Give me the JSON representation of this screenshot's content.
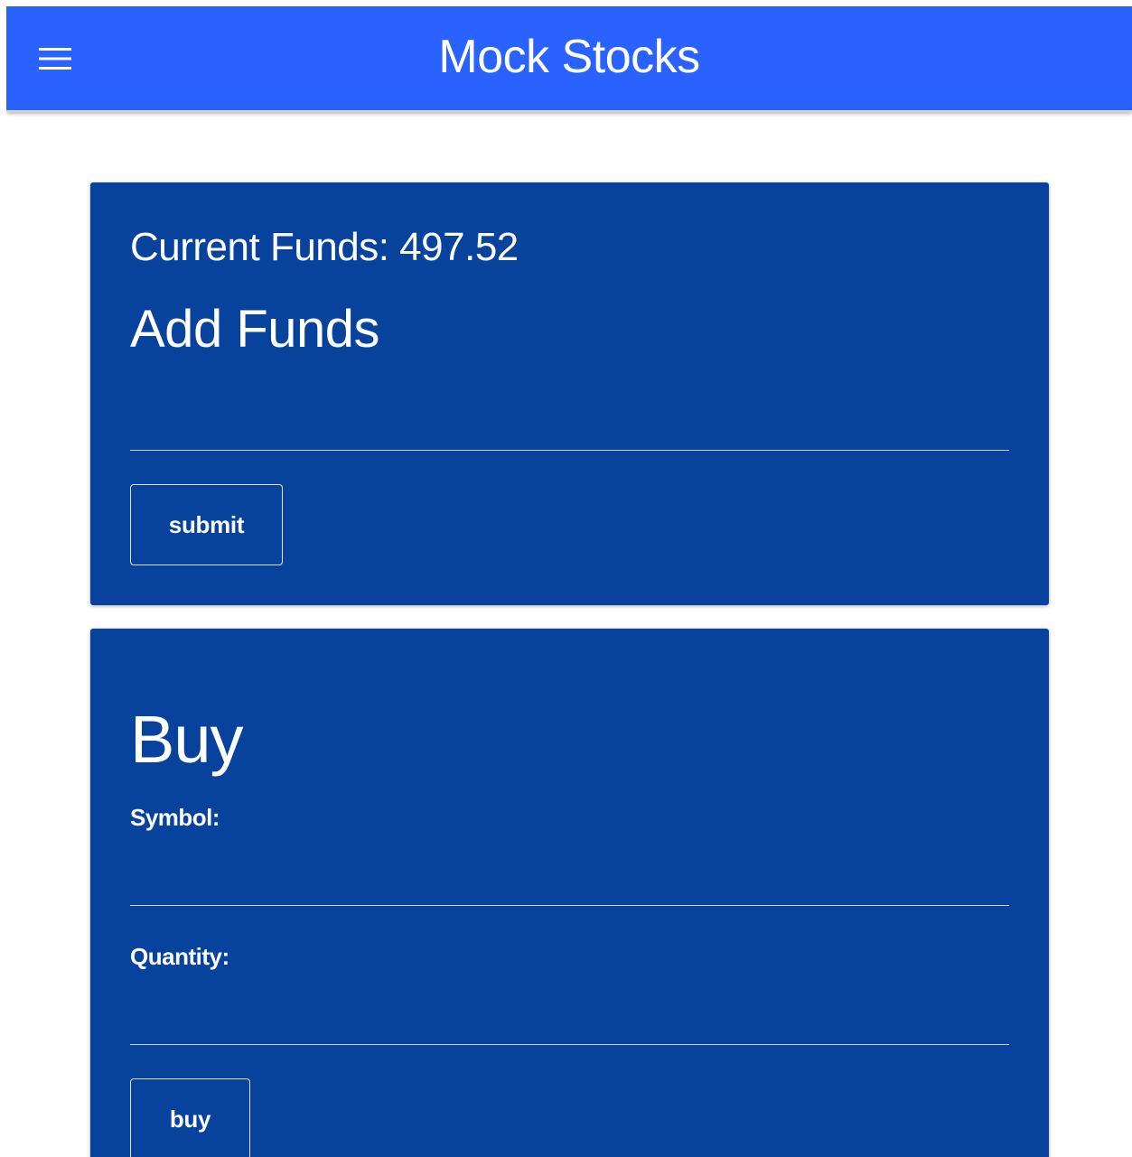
{
  "app": {
    "title": "Mock Stocks",
    "menu_icon": "hamburger-menu-icon",
    "colors": {
      "appbar": "#2962ff",
      "card": "#07439c",
      "text": "#ffffff"
    }
  },
  "funds_card": {
    "current_funds_label": "Current Funds: 497.52",
    "heading": "Add Funds",
    "amount_input": {
      "value": "",
      "placeholder": ""
    },
    "submit_label": "submit"
  },
  "buy_card": {
    "heading": "Buy",
    "symbol_label": "Symbol:",
    "symbol_input": {
      "value": "",
      "placeholder": ""
    },
    "quantity_label": "Quantity:",
    "quantity_input": {
      "value": "",
      "placeholder": ""
    },
    "buy_label": "buy"
  }
}
